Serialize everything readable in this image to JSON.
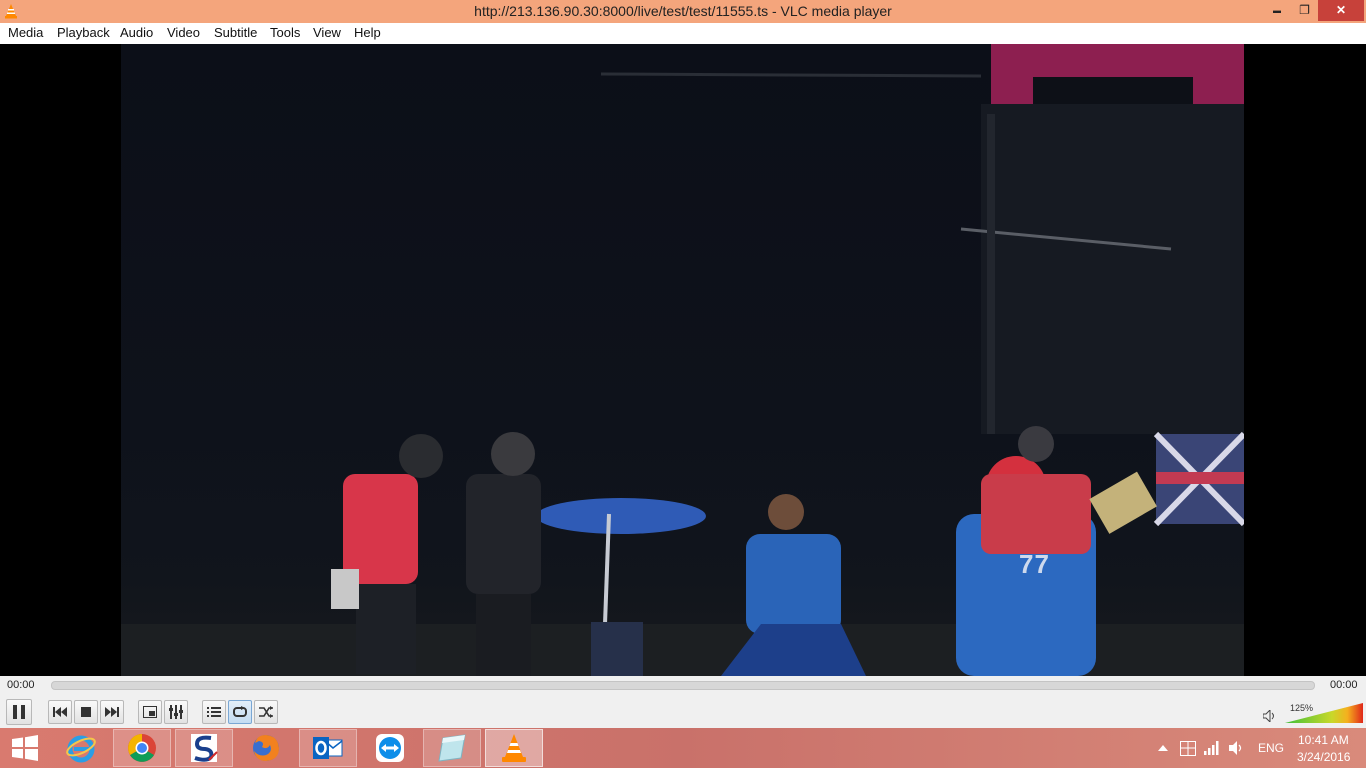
{
  "window": {
    "title": "http://213.136.90.30:8000/live/test/test/11555.ts - VLC media player",
    "minimize_glyph": "▬",
    "maximize_glyph": "❐",
    "close_glyph": "✕"
  },
  "menu": [
    "Media",
    "Playback",
    "Audio",
    "Video",
    "Subtitle",
    "Tools",
    "View",
    "Help"
  ],
  "player": {
    "time_elapsed": "00:00",
    "time_total": "00:00",
    "progress": 0,
    "volume_label": "125%",
    "volume_level": 1.25
  },
  "video": {
    "jersey_number": "77"
  },
  "controls": {
    "pause_icon": "pause-icon",
    "previous_icon": "skip-previous-icon",
    "stop_icon": "stop-icon",
    "next_icon": "skip-next-icon",
    "fullscreen_icon": "fullscreen-icon",
    "extended_settings_icon": "equalizer-icon",
    "playlist_icon": "playlist-icon",
    "loop_icon": "loop-icon",
    "random_icon": "shuffle-icon"
  },
  "taskbar": {
    "apps": [
      "start-icon",
      "internet-explorer-icon",
      "chrome-icon",
      "s-app-icon",
      "firefox-icon",
      "outlook-icon",
      "teamviewer-icon",
      "notes-app-icon",
      "vlc-icon"
    ],
    "language": "ENG",
    "time": "10:41 AM",
    "date": "3/24/2016"
  },
  "colors": {
    "titlebar": "#f4a57c",
    "close_button": "#c7413a",
    "taskbar": "#d97a6f",
    "vlc_orange": "#ff8800"
  }
}
